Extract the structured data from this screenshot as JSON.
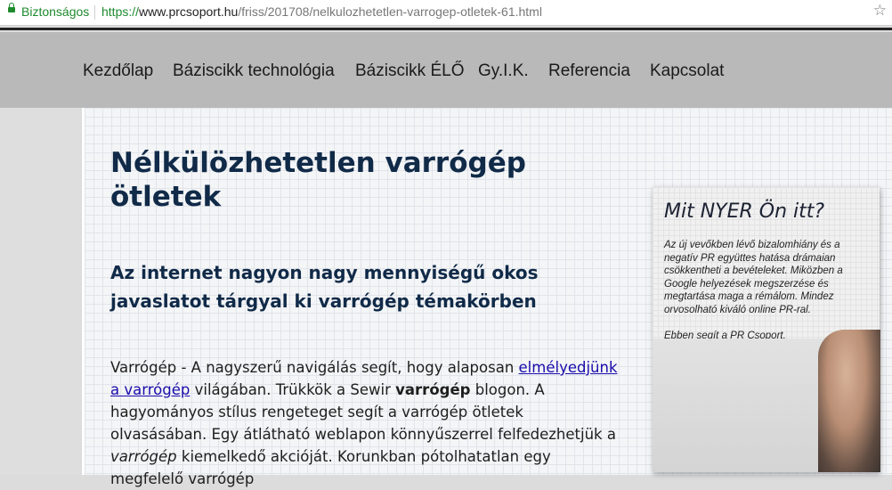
{
  "browser": {
    "security_label": "Biztonságos",
    "url_scheme": "https://",
    "url_host": "www.prcsoport.hu",
    "url_path": "/friss/201708/nelkulozhetetlen-varrogep-otletek-61.html",
    "bookmark_icon": "star-outline-icon"
  },
  "nav": {
    "items": [
      {
        "label": "Kezdőlap"
      },
      {
        "label": "Báziscikk technológia"
      },
      {
        "label": "Báziscikk ÉLŐ"
      },
      {
        "label": "Gy.I.K."
      },
      {
        "label": "Referencia"
      },
      {
        "label": "Kapcsolat"
      }
    ]
  },
  "article": {
    "title": "Nélkülözhetetlen varrógép ötletek",
    "subtitle": "Az internet nagyon nagy mennyiségű okos javaslatot tárgyal ki varrógép témakörben",
    "p1_a": "Varrógép - A nagyszerű navigálás segít, hogy alaposan ",
    "p1_link": "elmélyedjünk a varrógép",
    "p1_b": " világában. Trükkök a Sewir ",
    "p1_bold": "varrógép",
    "p1_c": " blogon. A hagyományos stílus rengeteget segít a varrógép ötletek olvasásában. Egy átlátható weblapon könnyűszerrel felfedezhetjük a ",
    "p1_italic": "varrógép",
    "p1_d": " kiemelkedő akcióját. Korunkban pótolhatatlan egy megfelelő varrógép"
  },
  "sidebar": {
    "title": "Mit NYER Ön itt?",
    "text": "Az új vevőkben lévő bizalomhiány és a negatív PR együttes hatása drámaian csökkentheti a bevételeket. Miközben a Google helyezések megszerzése és megtartása maga a rémálom. Mindez orvosolható kiváló online PR-ral.",
    "text2": "Ebben segít a PR Csoport."
  },
  "colors": {
    "heading": "#102a48",
    "secure": "#1e8a2e",
    "link": "#1a0dab",
    "nav_bg": "#b9b9b9"
  }
}
